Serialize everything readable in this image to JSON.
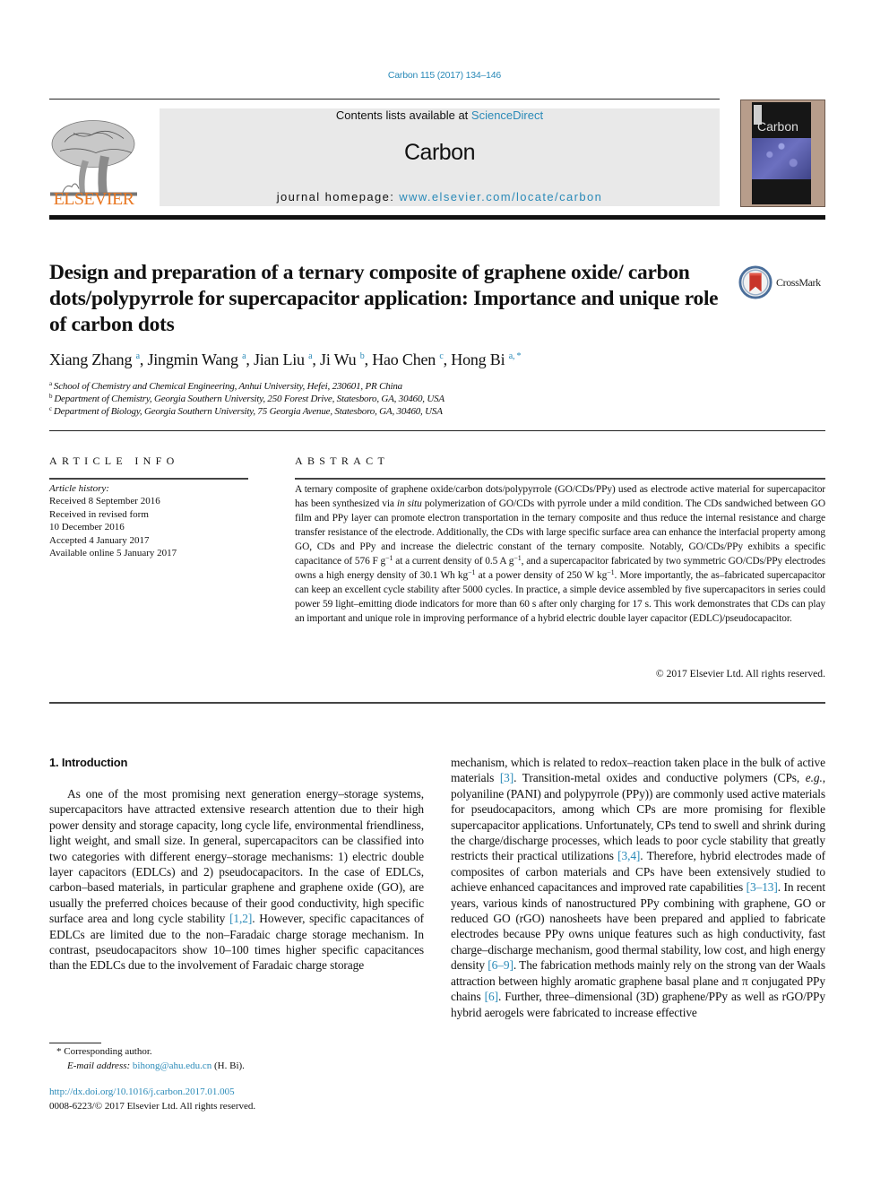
{
  "citation": "Carbon 115 (2017) 134–146",
  "header": {
    "contents_prefix": "Contents lists available at ",
    "contents_link": "ScienceDirect",
    "journal_name": "Carbon",
    "homepage_prefix": "journal homepage: ",
    "homepage_link": "www.elsevier.com/locate/carbon",
    "publisher": "ELSEVIER",
    "cover_title": "Carbon",
    "crossmark": "CrossMark"
  },
  "colors": {
    "link": "#2a8ab8",
    "elsevier_orange": "#e87722",
    "header_bar": "#e9e9e9"
  },
  "article": {
    "title": "Design and preparation of a ternary composite of graphene oxide/ carbon dots/polypyrrole for supercapacitor application: Importance and unique role of carbon dots",
    "authors": [
      {
        "name": "Xiang Zhang",
        "aff": "a"
      },
      {
        "name": "Jingmin Wang",
        "aff": "a"
      },
      {
        "name": "Jian Liu",
        "aff": "a"
      },
      {
        "name": "Ji Wu",
        "aff": "b"
      },
      {
        "name": "Hao Chen",
        "aff": "c"
      },
      {
        "name": "Hong Bi",
        "aff": "a, *"
      }
    ],
    "affiliations": [
      {
        "key": "a",
        "text": "School of Chemistry and Chemical Engineering, Anhui University, Hefei, 230601, PR China"
      },
      {
        "key": "b",
        "text": "Department of Chemistry, Georgia Southern University, 250 Forest Drive, Statesboro, GA, 30460, USA"
      },
      {
        "key": "c",
        "text": "Department of Biology, Georgia Southern University, 75 Georgia Avenue, Statesboro, GA, 30460, USA"
      }
    ]
  },
  "article_info": {
    "heading": "ARTICLE INFO",
    "history_label": "Article history:",
    "history": [
      "Received 8 September 2016",
      "Received in revised form",
      "10 December 2016",
      "Accepted 4 January 2017",
      "Available online 5 January 2017"
    ]
  },
  "abstract": {
    "heading": "ABSTRACT",
    "p1": "A ternary composite of graphene oxide/carbon dots/polypyrrole (GO/CDs/PPy) used as electrode active material for supercapacitor has been synthesized via ",
    "p1_em": "in situ",
    "p2": " polymerization of GO/CDs with pyrrole under a mild condition. The CDs sandwiched between GO film and PPy layer can promote electron transportation in the ternary composite and thus reduce the internal resistance and charge transfer resistance of the electrode. Additionally, the CDs with large specific surface area can enhance the interfacial property among GO, CDs and PPy and increase the dielectric constant of the ternary composite. Notably, GO/CDs/PPy exhibits a specific capacitance of 576 F g",
    "sup1": "−1",
    "p3": " at a current density of 0.5 A g",
    "sup2": "−1",
    "p4": ", and a supercapacitor fabricated by two symmetric GO/CDs/PPy electrodes owns a high energy density of 30.1 Wh kg",
    "sup3": "−1",
    "p5": " at a power density of 250 W kg",
    "sup4": "−1",
    "p6": ". More importantly, the as–fabricated supercapacitor can keep an excellent cycle stability after 5000 cycles. In practice, a simple device assembled by five supercapacitors in series could power 59 light–emitting diode indicators for more than 60 s after only charging for 17 s. This work demonstrates that CDs can play an important and unique role in improving performance of a hybrid electric double layer capacitor (EDLC)/pseudocapacitor.",
    "copyright": "© 2017 Elsevier Ltd. All rights reserved."
  },
  "introduction": {
    "heading": "1.  Introduction",
    "left_a": "As one of the most promising next generation energy–storage systems, supercapacitors have attracted extensive research attention due to their high power density and storage capacity, long cycle life, environmental friendliness, light weight, and small size. In general, supercapacitors can be classified into two categories with different energy–storage mechanisms: 1) electric double layer capacitors (EDLCs) and 2) pseudocapacitors. In the case of EDLCs, carbon–based materials, in particular graphene and graphene oxide (GO), are usually the preferred choices because of their good conductivity, high specific surface area and long cycle stability ",
    "ref_1_2": "[1,2]",
    "left_b": ". However, specific capacitances of EDLCs are limited due to the non–Faradaic charge storage mechanism. In contrast, pseudocapacitors show 10–100 times higher specific capacitances than the EDLCs due to the involvement of Faradaic charge storage",
    "right_a": "mechanism, which is related to redox–reaction taken place in the bulk of active materials ",
    "ref_3": "[3]",
    "right_b": ". Transition-metal oxides and conductive polymers (CPs, ",
    "right_eg": "e.g.",
    "right_c": ", polyaniline (PANI) and polypyrrole (PPy)) are commonly used active materials for pseudocapacitors, among which CPs are more promising for flexible supercapacitor applications. Unfortunately, CPs tend to swell and shrink during the charge/discharge processes, which leads to poor cycle stability that greatly restricts their practical utilizations ",
    "ref_3_4": "[3,4]",
    "right_d": ". Therefore, hybrid electrodes made of composites of carbon materials and CPs have been extensively studied to achieve enhanced capacitances and improved rate capabilities ",
    "ref_3_13": "[3–13]",
    "right_e": ". In recent years, various kinds of nanostructured PPy combining with graphene, GO or reduced GO (rGO) nanosheets have been prepared and applied to fabricate electrodes because PPy owns unique features such as high conductivity, fast charge–discharge mechanism, good thermal stability, low cost, and high energy density ",
    "ref_6_9": "[6–9]",
    "right_f": ". The fabrication methods mainly rely on the strong van der Waals attraction between highly aromatic graphene basal plane and π conjugated PPy chains ",
    "ref_6": "[6]",
    "right_g": ". Further, three–dimensional (3D) graphene/PPy as well as rGO/PPy hybrid aerogels were fabricated to increase effective"
  },
  "footnote": {
    "corresponding": "* Corresponding author.",
    "email_label": "E-mail address: ",
    "email": "bihong@ahu.edu.cn",
    "email_suffix": " (H. Bi).",
    "doi": "http://dx.doi.org/10.1016/j.carbon.2017.01.005",
    "issn": "0008-6223/© 2017 Elsevier Ltd. All rights reserved."
  }
}
